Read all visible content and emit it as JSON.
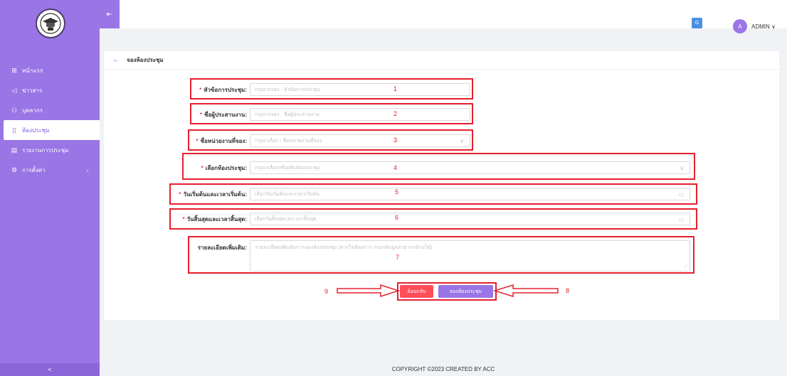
{
  "sidebar": {
    "items": [
      {
        "icon": "grid-icon",
        "glyph": "⊞",
        "label": "หน้าแรก"
      },
      {
        "icon": "megaphone-icon",
        "glyph": "◁",
        "label": "ข่าวสาร"
      },
      {
        "icon": "users-icon",
        "glyph": "⚇",
        "label": "บุคลากร"
      },
      {
        "icon": "door-icon",
        "glyph": "▯",
        "label": "ห้องประชุม"
      },
      {
        "icon": "report-icon",
        "glyph": "▤",
        "label": "รายงานการประชุม"
      },
      {
        "icon": "gear-icon",
        "glyph": "⚙",
        "label": "การตั้งค่า"
      }
    ],
    "collapse_glyph": "<",
    "settings_chevron": "⌄"
  },
  "topbar": {
    "collapse_glyph": "⇤",
    "translate_glyph": "G",
    "avatar_letter": "A",
    "user_name": "ADMIN ∨"
  },
  "card": {
    "back_glyph": "←",
    "title": "จองห้องประชุม"
  },
  "form": {
    "topic_label": "หัวข้อการประชุม:",
    "topic_placeholder": "กรุณากรอก : หัวข้อการประชุม",
    "coordinator_label": "ชื่อผู้ประสานงาน:",
    "coordinator_placeholder": "กรุณากรอก : ชื่อผู้ประสานงาน",
    "unit_label": "ชื่อหน่วยงานที่จอง:",
    "unit_placeholder": "กรุณาเลือก : ชื่อหน่วยงานที่จอง",
    "room_label": "เลือกห้องประชุม:",
    "room_placeholder": "กรุณาเลือกหรือเพิ่มห้องประชุม",
    "start_label": "วันเริ่มต้นและเวลาเริ่มต้น:",
    "start_placeholder": "เลือกวันเริ่มต้นและเวลาเริ่มต้น",
    "end_label": "วันสิ้นสุดและเวลาสิ้นสุด:",
    "end_placeholder": "เลือกวันสิ้นสุดและเวลาสิ้นสุด",
    "details_label": "รายละเอียดเพิ่มเติม:",
    "details_placeholder": "รายละเอียดเพิ่มเติมการจองห้องประชุม (หากไม่ต้องการ กรอกข้อมูลสามารถข้ามได้)",
    "required_mark": "*",
    "chevron": "∨",
    "calendar": "▭"
  },
  "buttons": {
    "back_label": "ย้อนกลับ",
    "submit_label": "จองห้องประชุม",
    "back_color": "#ff4d5a",
    "submit_color": "#9a75e6"
  },
  "annotations": [
    "1",
    "2",
    "3",
    "4",
    "5",
    "6",
    "7",
    "8",
    "9"
  ],
  "footer": {
    "text": "COPYRIGHT ©2023 CREATED BY ACC"
  },
  "colors": {
    "accent": "#9a75e6",
    "annotation": "#e5202e"
  }
}
